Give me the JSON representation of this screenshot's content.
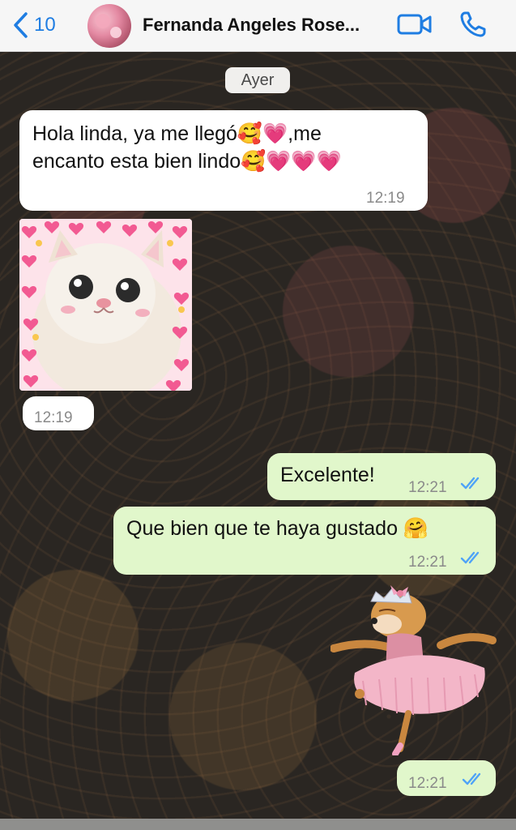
{
  "header": {
    "back_count": "10",
    "contact_name": "Fernanda Angeles  Rose..."
  },
  "chat": {
    "date_divider": "Ayer",
    "messages": [
      {
        "direction": "incoming",
        "type": "text",
        "line1": "Hola linda, ya me llegó🥰💗,me",
        "line2": "encanto esta bien lindo🥰💗💗💗",
        "time": "12:19"
      },
      {
        "direction": "incoming",
        "type": "image",
        "description": "cat-with-hearts",
        "time": "12:19"
      },
      {
        "direction": "outgoing",
        "type": "text",
        "text": "Excelente!",
        "time": "12:21",
        "status": "read"
      },
      {
        "direction": "outgoing",
        "type": "text",
        "text": "Que bien que te haya gustado 🤗",
        "time": "12:21",
        "status": "read"
      },
      {
        "direction": "outgoing",
        "type": "sticker",
        "description": "dog-ballerina-sticker",
        "time": "12:21",
        "status": "read"
      }
    ]
  },
  "icons": {
    "back": "chevron-left-icon",
    "video": "video-camera-icon",
    "call": "phone-icon",
    "read_receipt": "double-check-icon"
  },
  "colors": {
    "accent": "#1f7de2",
    "incoming_bubble": "#ffffff",
    "outgoing_bubble": "#e1f7cb",
    "read_check": "#4fa3f7"
  }
}
